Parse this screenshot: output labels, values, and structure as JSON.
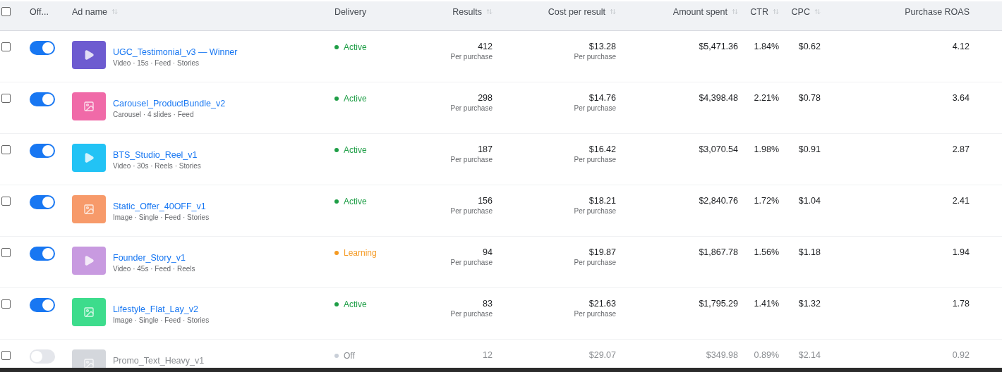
{
  "header": {
    "select_all": {
      "checked": false
    },
    "columns": [
      {
        "label": "Off...",
        "sortable": false
      },
      {
        "label": "Ad name",
        "sortable": true
      },
      {
        "label": "Delivery",
        "sortable": false
      },
      {
        "label": "Results",
        "sortable": true
      },
      {
        "label": "Cost per result",
        "sortable": true
      },
      {
        "label": "Amount spent",
        "sortable": true
      },
      {
        "label": "CTR",
        "sortable": true
      },
      {
        "label": "CPC",
        "sortable": true
      },
      {
        "label": "Purchase ROAS",
        "sortable": false
      }
    ]
  },
  "rows": [
    {
      "checked": false,
      "on": true,
      "thumb": {
        "kind": "video",
        "color": "#6d5bd0"
      },
      "name": "UGC_Testimonial_v3 — Winner",
      "details": "Video · 15s · Feed · Stories",
      "delivery": {
        "label": "Active",
        "color": "#1e9e46"
      },
      "results": "412",
      "results_note": "Per purchase",
      "cost": "$13.28",
      "cost_note": "Per purchase",
      "spent": "$5,471.36",
      "ctr": "1.84%",
      "cpc": "$0.62",
      "roas": "4.12"
    },
    {
      "checked": false,
      "on": true,
      "thumb": {
        "kind": "image",
        "color": "#f06aa8"
      },
      "name": "Carousel_ProductBundle_v2",
      "details": "Carousel · 4 slides · Feed",
      "delivery": {
        "label": "Active",
        "color": "#1e9e46"
      },
      "results": "298",
      "results_note": "Per purchase",
      "cost": "$14.76",
      "cost_note": "Per purchase",
      "spent": "$4,398.48",
      "ctr": "2.21%",
      "cpc": "$0.78",
      "roas": "3.64"
    },
    {
      "checked": false,
      "on": true,
      "thumb": {
        "kind": "video",
        "color": "#22c3f5"
      },
      "name": "BTS_Studio_Reel_v1",
      "details": "Video · 30s · Reels · Stories",
      "delivery": {
        "label": "Active",
        "color": "#1e9e46"
      },
      "results": "187",
      "results_note": "Per purchase",
      "cost": "$16.42",
      "cost_note": "Per purchase",
      "spent": "$3,070.54",
      "ctr": "1.98%",
      "cpc": "$0.91",
      "roas": "2.87"
    },
    {
      "checked": false,
      "on": true,
      "thumb": {
        "kind": "image",
        "color": "#f79a6a"
      },
      "name": "Static_Offer_40OFF_v1",
      "details": "Image · Single · Feed · Stories",
      "delivery": {
        "label": "Active",
        "color": "#1e9e46"
      },
      "results": "156",
      "results_note": "Per purchase",
      "cost": "$18.21",
      "cost_note": "Per purchase",
      "spent": "$2,840.76",
      "ctr": "1.72%",
      "cpc": "$1.04",
      "roas": "2.41"
    },
    {
      "checked": false,
      "on": true,
      "thumb": {
        "kind": "video",
        "color": "#c89ae0"
      },
      "name": "Founder_Story_v1",
      "details": "Video · 45s · Feed · Reels",
      "delivery": {
        "label": "Learning",
        "color": "#f59a23"
      },
      "results": "94",
      "results_note": "Per purchase",
      "cost": "$19.87",
      "cost_note": "Per purchase",
      "spent": "$1,867.78",
      "ctr": "1.56%",
      "cpc": "$1.18",
      "roas": "1.94"
    },
    {
      "checked": false,
      "on": true,
      "thumb": {
        "kind": "image",
        "color": "#3ddc8c"
      },
      "name": "Lifestyle_Flat_Lay_v2",
      "details": "Image · Single · Feed · Stories",
      "delivery": {
        "label": "Active",
        "color": "#1e9e46"
      },
      "results": "83",
      "results_note": "Per purchase",
      "cost": "$21.63",
      "cost_note": "Per purchase",
      "spent": "$1,795.29",
      "ctr": "1.41%",
      "cpc": "$1.32",
      "roas": "1.78"
    },
    {
      "checked": false,
      "on": false,
      "thumb": {
        "kind": "image",
        "color": "#d4d7dc"
      },
      "name": "Promo_Text_Heavy_v1",
      "delivery": {
        "label": "Off",
        "color": "#c9cfd8"
      },
      "results": "12",
      "cost": "$29.07",
      "spent": "$349.98",
      "ctr": "0.89%",
      "cpc": "$2.14",
      "roas": "0.92"
    }
  ]
}
